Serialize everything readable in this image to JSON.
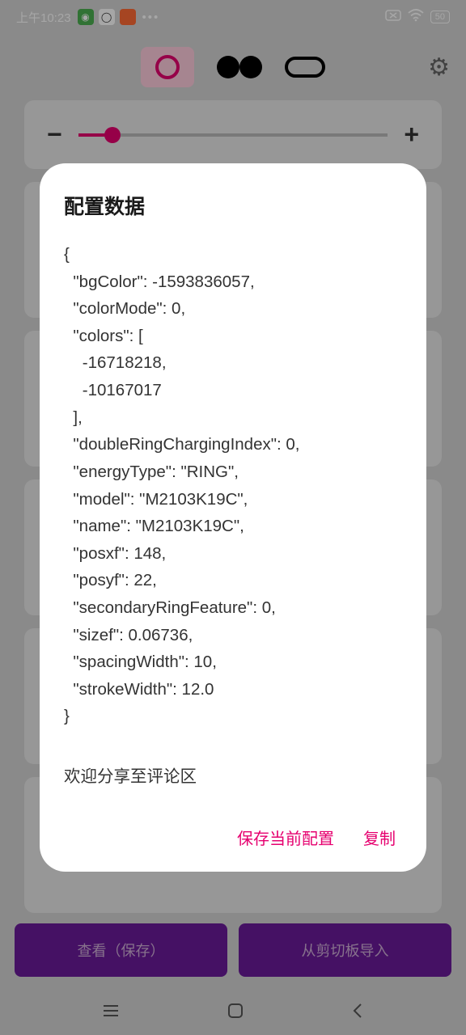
{
  "statusBar": {
    "time": "上午10:23",
    "dots": "•••",
    "battery": "50"
  },
  "bottomButtons": {
    "view": "查看（保存）",
    "import": "从剪切板导入"
  },
  "dialog": {
    "title": "配置数据",
    "json": "{\n  \"bgColor\": -1593836057,\n  \"colorMode\": 0,\n  \"colors\": [\n    -16718218,\n    -10167017\n  ],\n  \"doubleRingChargingIndex\": 0,\n  \"energyType\": \"RING\",\n  \"model\": \"M2103K19C\",\n  \"name\": \"M2103K19C\",\n  \"posxf\": 148,\n  \"posyf\": 22,\n  \"secondaryRingFeature\": 0,\n  \"sizef\": 0.06736,\n  \"spacingWidth\": 10,\n  \"strokeWidth\": 12.0\n}",
    "shareText": "欢迎分享至评论区",
    "saveAction": "保存当前配置",
    "copyAction": "复制"
  }
}
